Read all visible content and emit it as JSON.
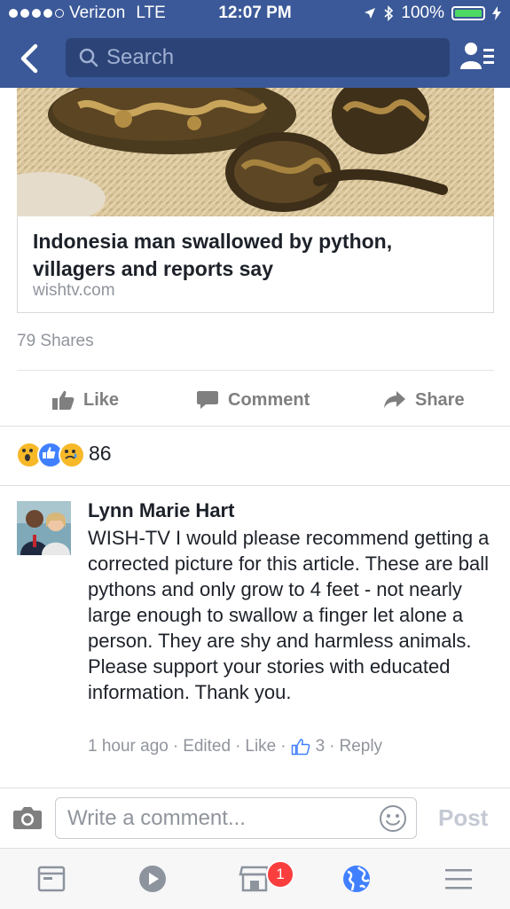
{
  "status_bar": {
    "carrier": "Verizon",
    "network": "LTE",
    "time": "12:07 PM",
    "battery": "100%"
  },
  "header": {
    "search_placeholder": "Search"
  },
  "article": {
    "title": "Indonesia man swallowed by python, villagers and reports say",
    "source": "wishtv.com"
  },
  "shares": "79 Shares",
  "actions": {
    "like": "Like",
    "comment": "Comment",
    "share": "Share"
  },
  "reactions": {
    "count": "86",
    "types": [
      "wow",
      "like",
      "sad"
    ]
  },
  "comment": {
    "author": "Lynn Marie Hart",
    "body": "WISH-TV I would please recommend getting a corrected picture for this article. These are ball pythons and only grow to 4 feet - not nearly large enough to swallow a finger let alone a person. They are shy and harmless animals. Please support your stories with educated information. Thank you.",
    "time": "1 hour ago",
    "edited": "Edited",
    "like": "Like",
    "like_count": "3",
    "reply": "Reply"
  },
  "composer": {
    "placeholder": "Write a comment...",
    "post": "Post"
  },
  "tabbar": {
    "marketplace_badge": "1"
  },
  "colors": {
    "brand": "#3b5998",
    "link": "#4080ff"
  }
}
